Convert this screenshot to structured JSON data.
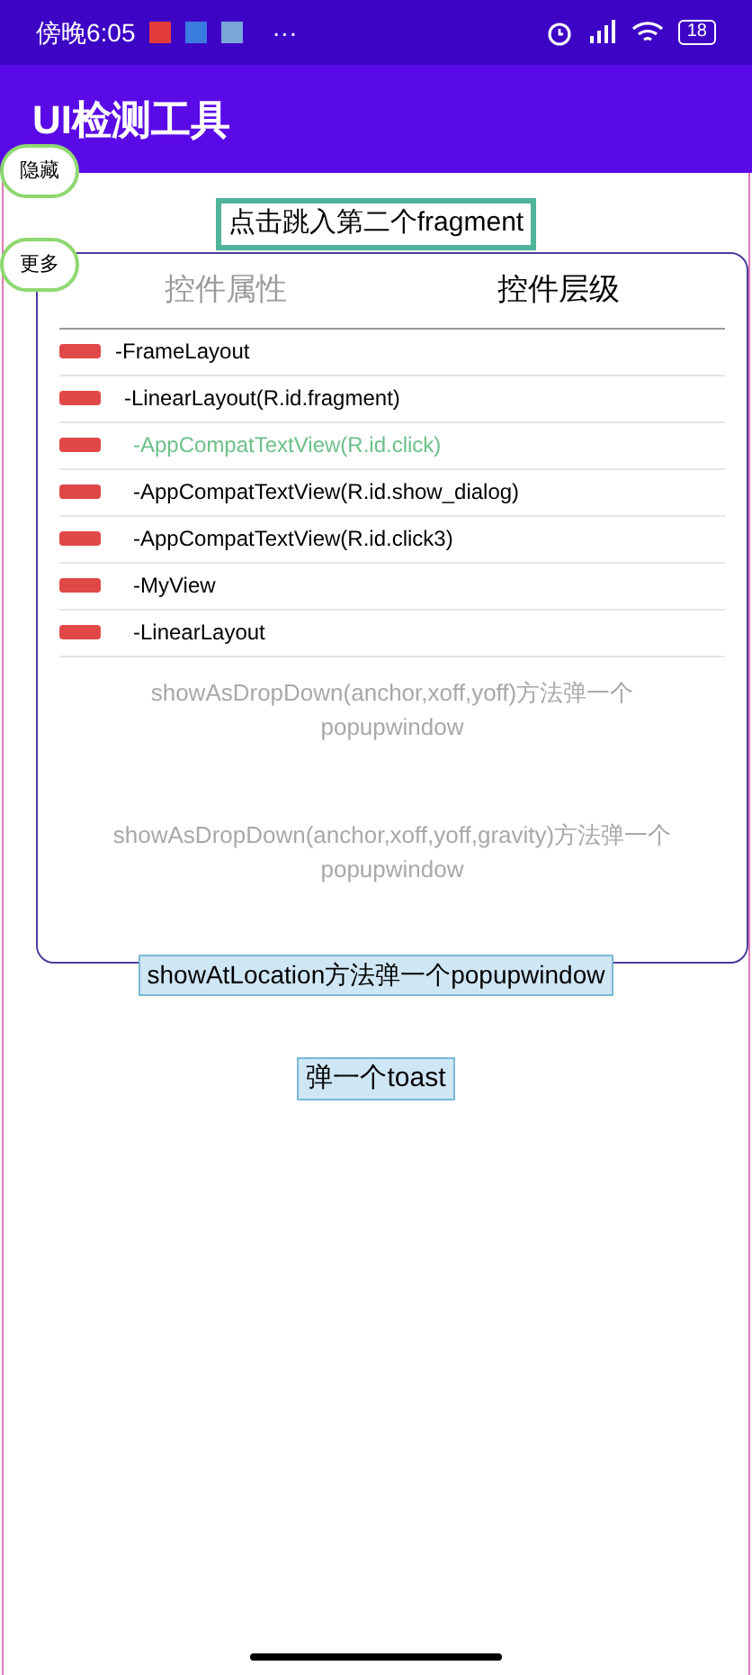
{
  "status_bar": {
    "time": "傍晚6:05",
    "more": "···",
    "battery": "18"
  },
  "app_bar": {
    "title": "UI检测工具"
  },
  "floating_buttons": [
    {
      "label": "隐藏"
    },
    {
      "label": "更多"
    }
  ],
  "top_button": {
    "label": "点击跳入第二个fragment"
  },
  "panel": {
    "tabs": [
      {
        "label": "控件属性",
        "selected": false
      },
      {
        "label": "控件层级",
        "selected": true
      }
    ],
    "tree": [
      {
        "label": "-FrameLayout",
        "selected": false,
        "children": [
          {
            "label": "-LinearLayout(R.id.fragment)",
            "selected": false,
            "children": [
              {
                "label": "-AppCompatTextView(R.id.click)",
                "selected": true
              },
              {
                "label": "-AppCompatTextView(R.id.show_dialog)",
                "selected": false
              },
              {
                "label": "-AppCompatTextView(R.id.click3)",
                "selected": false
              },
              {
                "label": "-MyView",
                "selected": false
              },
              {
                "label": "-LinearLayout",
                "selected": false
              }
            ]
          }
        ]
      }
    ],
    "behind_texts": [
      "showAsDropDown(anchor,xoff,yoff)方法弹一个popupwindow",
      "showAsDropDown(anchor,xoff,yoff,gravity)方法弹一个popupwindow"
    ]
  },
  "buttons": [
    {
      "label": "showAtLocation方法弹一个popupwindow"
    },
    {
      "label": "弹一个toast"
    }
  ]
}
